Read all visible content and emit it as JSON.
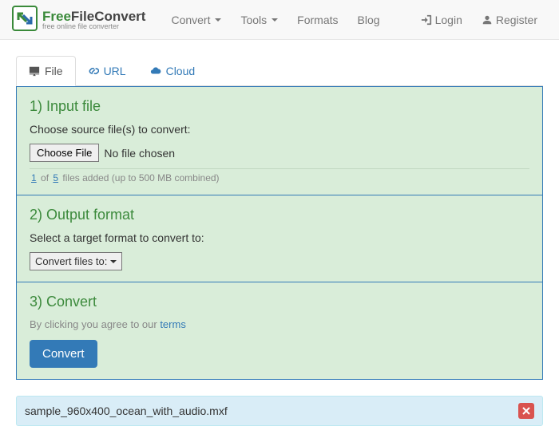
{
  "brand": {
    "title_free": "Free",
    "title_rest": "FileConvert",
    "subtitle": "free online file converter"
  },
  "nav": {
    "convert": "Convert",
    "tools": "Tools",
    "formats": "Formats",
    "blog": "Blog",
    "login": "Login",
    "register": "Register"
  },
  "tabs": {
    "file": "File",
    "url": "URL",
    "cloud": "Cloud"
  },
  "step1": {
    "title": "1) Input file",
    "text": "Choose source file(s) to convert:",
    "choose": "Choose File",
    "nofile": "No file chosen",
    "hint_n1": "1",
    "hint_of": "of",
    "hint_n2": "5",
    "hint_rest": "files added (up to 500 MB combined)"
  },
  "step2": {
    "title": "2) Output format",
    "text": "Select a target format to convert to:",
    "select": "Convert files to:"
  },
  "step3": {
    "title": "3) Convert",
    "agree_pre": "By clicking you agree to our ",
    "terms": "terms",
    "button": "Convert"
  },
  "queued_file": "sample_960x400_ocean_with_audio.mxf"
}
